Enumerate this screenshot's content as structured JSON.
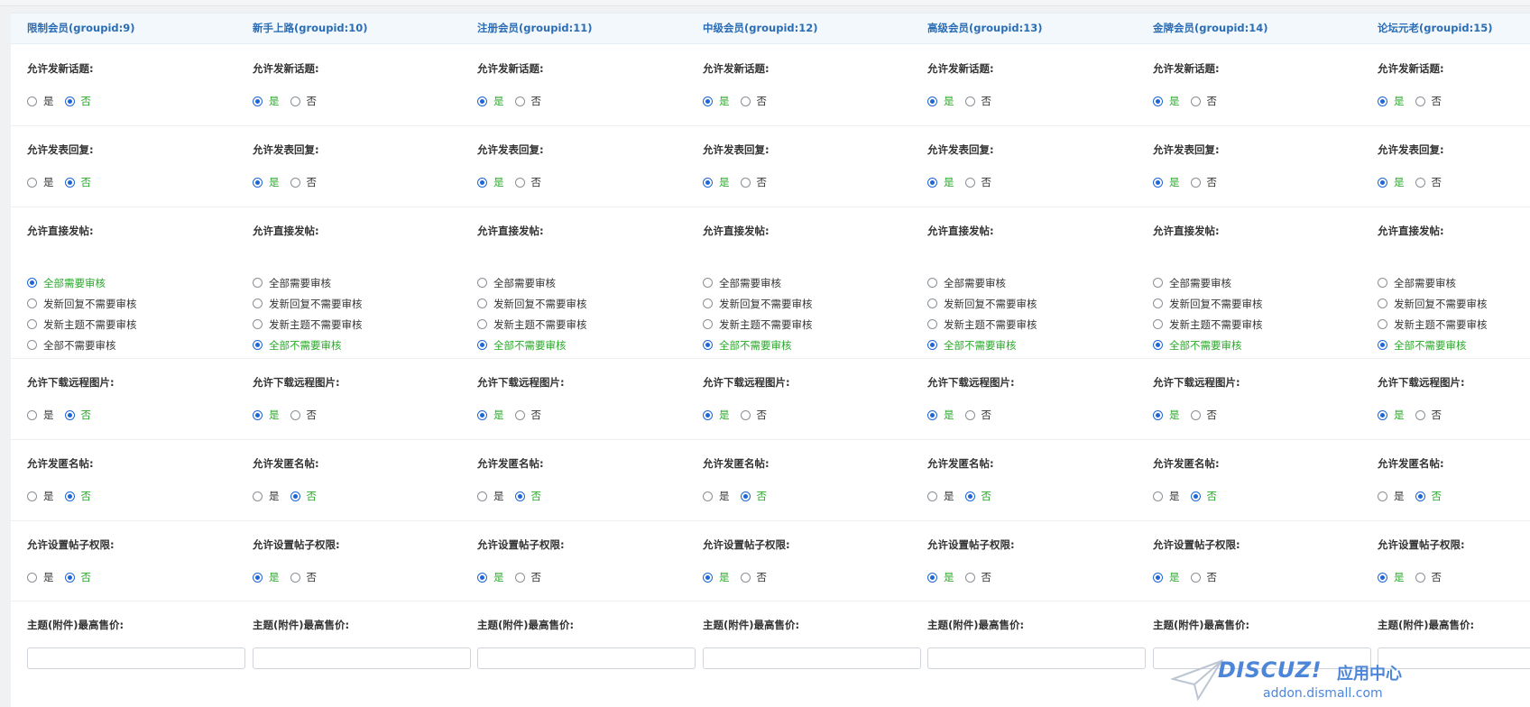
{
  "columns": [
    {
      "title": "限制会员(groupid:9)"
    },
    {
      "title": "新手上路(groupid:10)"
    },
    {
      "title": "注册会员(groupid:11)"
    },
    {
      "title": "中级会员(groupid:12)"
    },
    {
      "title": "高级会员(groupid:13)"
    },
    {
      "title": "金牌会员(groupid:14)"
    },
    {
      "title": "论坛元老(groupid:15)"
    }
  ],
  "options": {
    "yes": "是",
    "no": "否"
  },
  "sections": [
    {
      "label": "允许发新话题:",
      "type": "yesno",
      "values": [
        "no",
        "yes",
        "yes",
        "yes",
        "yes",
        "yes",
        "yes"
      ]
    },
    {
      "label": "允许发表回复:",
      "type": "yesno",
      "values": [
        "no",
        "yes",
        "yes",
        "yes",
        "yes",
        "yes",
        "yes"
      ]
    },
    {
      "label": "允许直接发帖:",
      "type": "multi",
      "choices": [
        "全部需要审核",
        "发新回复不需要审核",
        "发新主题不需要审核",
        "全部不需要审核"
      ],
      "values": [
        0,
        3,
        3,
        3,
        3,
        3,
        3
      ]
    },
    {
      "label": "允许下载远程图片:",
      "type": "yesno",
      "values": [
        "no",
        "yes",
        "yes",
        "yes",
        "yes",
        "yes",
        "yes"
      ]
    },
    {
      "label": "允许发匿名帖:",
      "type": "yesno",
      "values": [
        "no",
        "no",
        "no",
        "no",
        "no",
        "no",
        "no"
      ]
    },
    {
      "label": "允许设置帖子权限:",
      "type": "yesno",
      "values": [
        "no",
        "yes",
        "yes",
        "yes",
        "yes",
        "yes",
        "yes"
      ]
    },
    {
      "label": "主题(附件)最高售价:",
      "type": "input",
      "values": [
        "",
        "",
        "",
        "",
        "",
        "",
        ""
      ]
    }
  ],
  "watermark": {
    "logo": "DISCUZ!",
    "app": "应用中心",
    "url": "addon.dismall.com"
  },
  "colors": {
    "accent": "#1e66d6",
    "selected_text": "#27a827",
    "header_text": "#2a6db5"
  }
}
